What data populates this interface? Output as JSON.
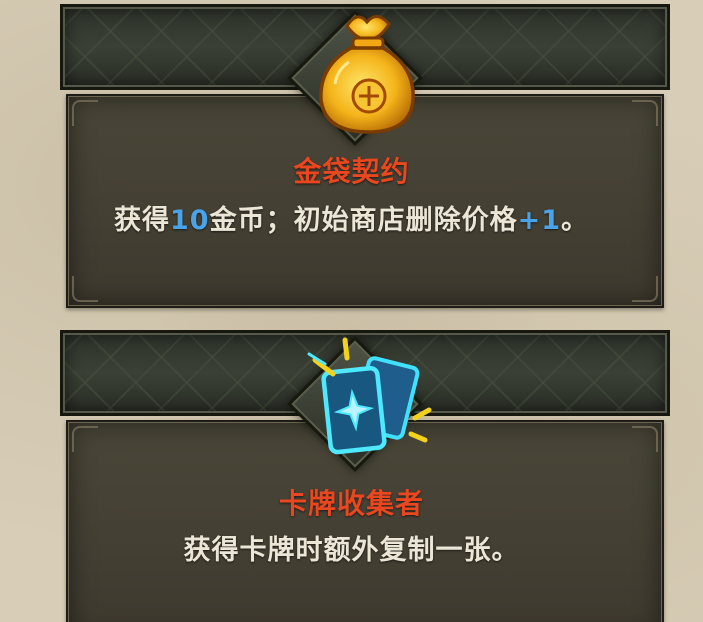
{
  "relics": [
    {
      "icon": "gold-bag-icon",
      "title": "金袋契约",
      "desc_parts": [
        "获得",
        "10",
        "金币；初始商店删除价格",
        "+1",
        "。"
      ]
    },
    {
      "icon": "cards-icon",
      "title": "卡牌收集者",
      "desc": "获得卡牌时额外复制一张。"
    }
  ],
  "colors": {
    "title": "#e8471f",
    "highlight": "#4aa3e8",
    "text": "#ece6d6"
  }
}
